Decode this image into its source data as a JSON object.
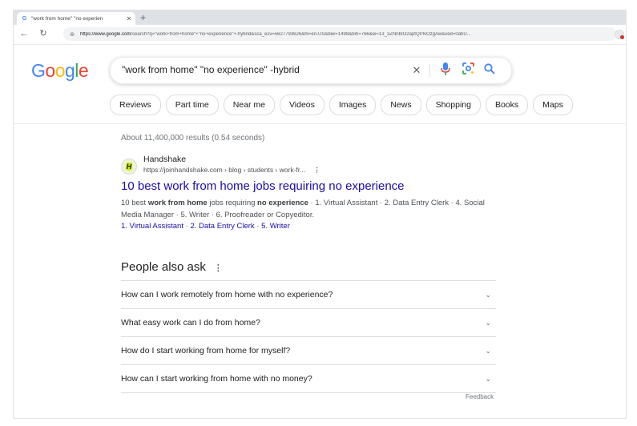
{
  "browser": {
    "tab_title": "\"work from home\" \"no experien",
    "tab_favicon": "G",
    "url_host": "https://www.google.com",
    "url_path": "/search?q=\"work+from+home\"+\"no+experience\"+-hybrid&sca_esv=5627793626&hl=en-US&biw=1498&bih=766&ei=13_3ZNnbIO2aptQPlvOzgAw&ved=0ahU..."
  },
  "search": {
    "logo": "Google",
    "query": "\"work from home\" \"no experience\" -hybrid"
  },
  "chips": [
    "Reviews",
    "Part time",
    "Near me",
    "Videos",
    "Images",
    "News",
    "Shopping",
    "Books",
    "Maps"
  ],
  "results_stats": "About 11,400,000 results (0.54 seconds)",
  "result": {
    "favicon_letter": "H",
    "site_name": "Handshake",
    "cite": "https://joinhandshake.com › blog › students › work-fr...",
    "title": "10 best work from home jobs requiring no experience",
    "snippet_parts": {
      "p1": "10 best ",
      "b1": "work from home",
      "p2": " jobs requiring ",
      "b2": "no experience",
      "p3": " · 1. Virtual Assistant · 2. Data Entry Clerk · 4. Social Media Manager · 5. Writer · 6. Proofreader or Copyeditor."
    },
    "sitelinks": [
      "1. Virtual Assistant",
      "2. Data Entry Clerk",
      "5. Writer"
    ]
  },
  "paa": {
    "title": "People also ask",
    "questions": [
      "How can I work remotely from home with no experience?",
      "What easy work can I do from home?",
      "How do I start working from home for myself?",
      "How can I start working from home with no money?"
    ],
    "feedback": "Feedback"
  },
  "colors": {
    "link": "#1a0dab",
    "logo_blue": "#4285f4",
    "logo_red": "#ea4335",
    "logo_yellow": "#fbbc05",
    "logo_green": "#34a853"
  }
}
